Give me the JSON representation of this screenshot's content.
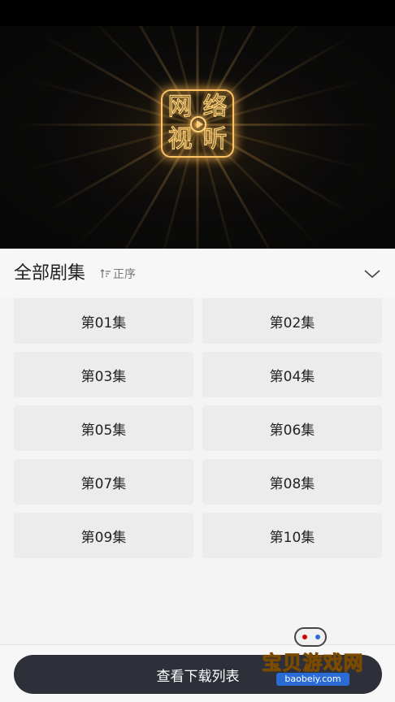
{
  "video": {
    "logo_chars": [
      "网",
      "络",
      "视",
      "听"
    ]
  },
  "episodes": {
    "title": "全部剧集",
    "sort_label": "正序",
    "items": [
      "第01集",
      "第02集",
      "第03集",
      "第04集",
      "第05集",
      "第06集",
      "第07集",
      "第08集",
      "第09集",
      "第10集"
    ]
  },
  "footer": {
    "download_list_label": "查看下载列表"
  },
  "watermark": {
    "text": "宝贝游戏网",
    "url": "baobeiy.com"
  },
  "colors": {
    "background": "#f4f4f4",
    "episode_button": "#ececec",
    "primary_button": "#2d3038",
    "logo_glow": "#ffc266"
  }
}
